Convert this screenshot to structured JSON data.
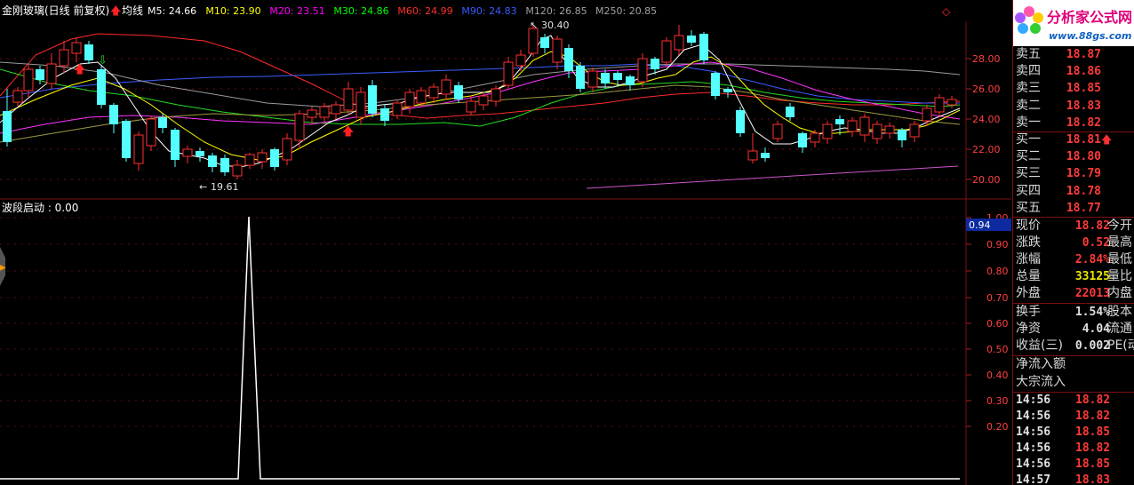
{
  "header": {
    "stock_name": "金刚玻璃(日线 前复权)",
    "ma_label": "均线",
    "ma": [
      {
        "text": "M5: 24.66",
        "color": "#ffffff"
      },
      {
        "text": "M10: 23.90",
        "color": "#ffff00"
      },
      {
        "text": "M20: 23.51",
        "color": "#ff00ff"
      },
      {
        "text": "M30: 24.86",
        "color": "#00ff00"
      },
      {
        "text": "M60: 24.99",
        "color": "#ff3030"
      },
      {
        "text": "M90: 24.83",
        "color": "#3a5cff"
      },
      {
        "text": "M120: 26.85",
        "color": "#a0a0a0"
      },
      {
        "text": "M250: 20.85",
        "color": "#a0a0a0"
      }
    ]
  },
  "price_axis": [
    "28.00",
    "26.00",
    "24.00",
    "22.00",
    "20.00"
  ],
  "annotations": {
    "high": "30.40",
    "low": "19.61"
  },
  "indicator": {
    "title": "波段启动 : 0.00",
    "current_value_box": "0.94",
    "axis": [
      "1.00",
      "0.90",
      "0.80",
      "0.70",
      "0.60",
      "0.50",
      "0.40",
      "0.30",
      "0.20"
    ]
  },
  "order_book": [
    {
      "label": "卖五",
      "price": "18.87"
    },
    {
      "label": "卖四",
      "price": "18.86"
    },
    {
      "label": "卖三",
      "price": "18.85"
    },
    {
      "label": "卖二",
      "price": "18.83"
    },
    {
      "label": "卖一",
      "price": "18.82"
    },
    {
      "label": "买一",
      "price": "18.81"
    },
    {
      "label": "买二",
      "price": "18.80"
    },
    {
      "label": "买三",
      "price": "18.79"
    },
    {
      "label": "买四",
      "price": "18.78"
    },
    {
      "label": "买五",
      "price": "18.77"
    }
  ],
  "quote": [
    {
      "label": "现价",
      "value": "18.82",
      "color": "#ff3b3b",
      "tail": "今开"
    },
    {
      "label": "涨跌",
      "value": "0.52",
      "color": "#ff3b3b",
      "tail": "最高"
    },
    {
      "label": "涨幅",
      "value": "2.84%",
      "color": "#ff3b3b",
      "tail": "最低"
    },
    {
      "label": "总量",
      "value": "33125",
      "color": "#e8e800",
      "tail": "量比"
    },
    {
      "label": "外盘",
      "value": "22013",
      "color": "#ff3b3b",
      "tail": "内盘"
    },
    {
      "label": "换手",
      "value": "1.54%",
      "color": "#e0e0e0",
      "tail": "股本"
    },
    {
      "label": "净资",
      "value": "4.04",
      "color": "#e0e0e0",
      "tail": "流通"
    },
    {
      "label": "收益(三)",
      "value": "0.002",
      "color": "#e0e0e0",
      "tail": "PE(动)"
    }
  ],
  "fund_flow": [
    "净流入额",
    "大宗流入"
  ],
  "ticks": [
    {
      "time": "14:56",
      "price": "18.82"
    },
    {
      "time": "14:56",
      "price": "18.82"
    },
    {
      "time": "14:56",
      "price": "18.85"
    },
    {
      "time": "14:56",
      "price": "18.82"
    },
    {
      "time": "14:56",
      "price": "18.85"
    },
    {
      "time": "14:57",
      "price": "18.83"
    }
  ],
  "logo": {
    "text": "分析家公式网",
    "url": "www.88gs.com"
  }
}
